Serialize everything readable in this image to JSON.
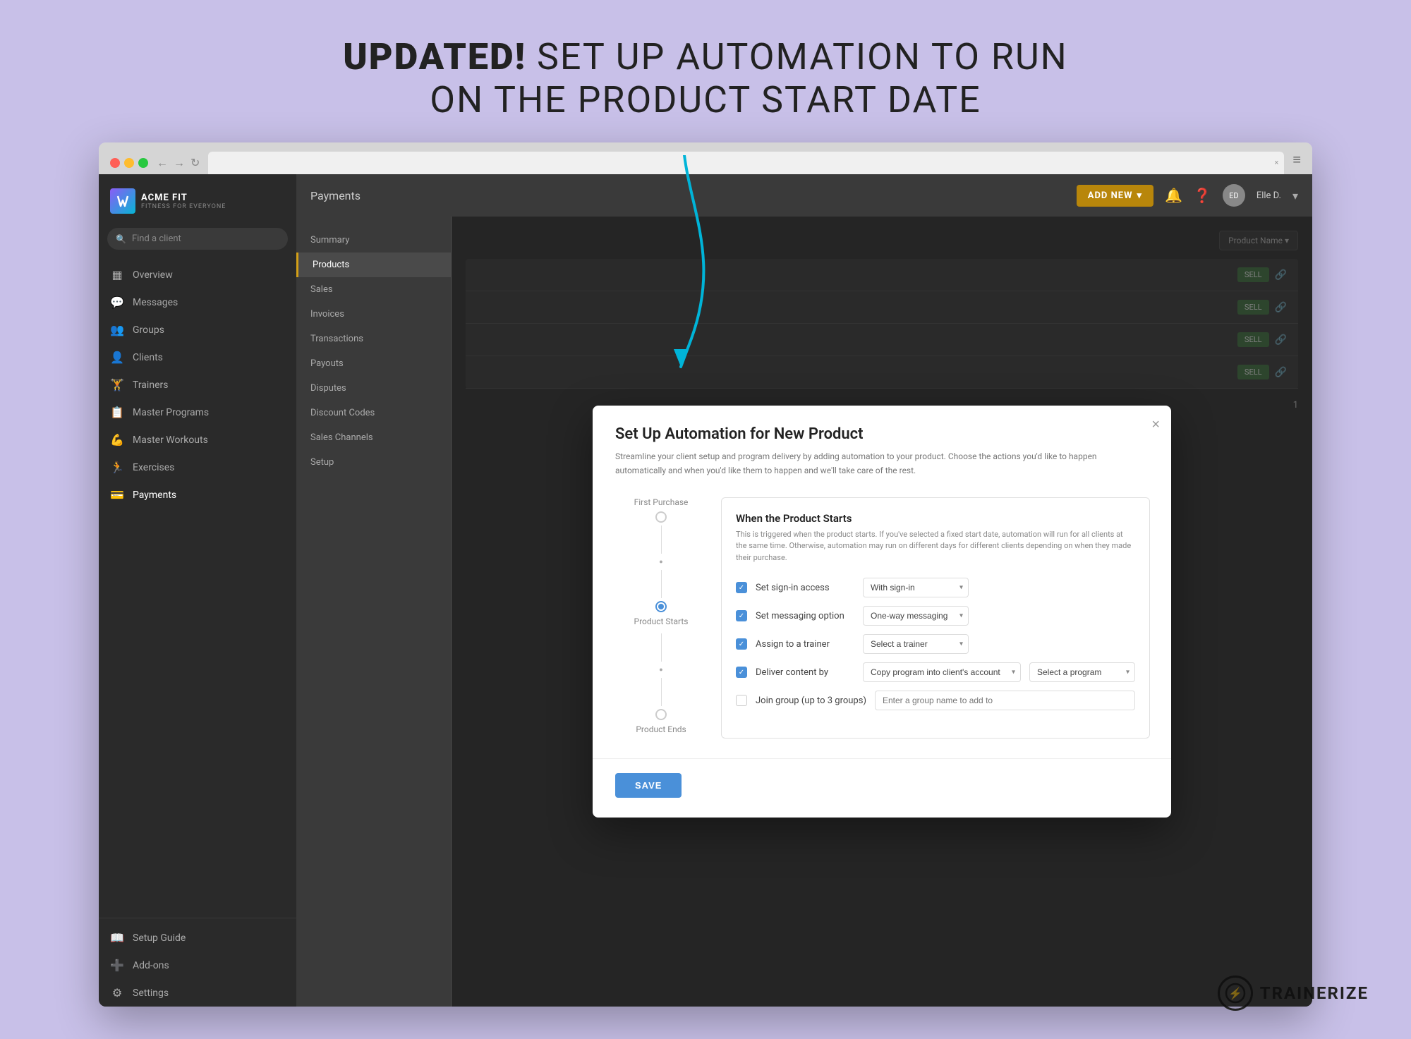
{
  "page": {
    "header_line1": "UPDATED! SET UP AUTOMATION TO RUN",
    "header_line2": "ON THE PRODUCT START DATE",
    "header_bold": "UPDATED!"
  },
  "browser": {
    "tab_label": "",
    "tab_close": "×",
    "menu_icon": "≡"
  },
  "sidebar": {
    "logo_text": "ACME FIT",
    "logo_sub": "FITNESS FOR EVERYONE",
    "search_placeholder": "Find a client",
    "items": [
      {
        "label": "Overview",
        "icon": "▦"
      },
      {
        "label": "Messages",
        "icon": "💬"
      },
      {
        "label": "Groups",
        "icon": "👥"
      },
      {
        "label": "Clients",
        "icon": "👤"
      },
      {
        "label": "Trainers",
        "icon": "🏋"
      },
      {
        "label": "Master Programs",
        "icon": "📋"
      },
      {
        "label": "Master Workouts",
        "icon": "💪"
      },
      {
        "label": "Exercises",
        "icon": "🏃"
      },
      {
        "label": "Payments",
        "icon": "💳"
      }
    ],
    "bottom_items": [
      {
        "label": "Setup Guide",
        "icon": "📖"
      },
      {
        "label": "Add-ons",
        "icon": "➕"
      },
      {
        "label": "Settings",
        "icon": "⚙"
      }
    ]
  },
  "topbar": {
    "title": "Payments",
    "add_new": "ADD NEW",
    "user_name": "Elle D."
  },
  "sub_nav": {
    "items": [
      "Summary",
      "Products",
      "Sales",
      "Invoices",
      "Transactions",
      "Payouts",
      "Disputes",
      "Discount Codes",
      "Sales Channels",
      "Setup"
    ]
  },
  "left_sidebar": {
    "items": [
      "Summary",
      "Products",
      "Sales",
      "Invoices",
      "Transactions",
      "Payouts",
      "Disputes",
      "Discount Codes",
      "Sales Channels",
      "Setup"
    ]
  },
  "modal": {
    "title": "Set Up Automation for New Product",
    "description": "Streamline your client setup and program delivery by adding automation to your product. Choose the actions you'd like to happen automatically and when you'd like them to happen and we'll take care of the rest.",
    "close_label": "×",
    "timeline": [
      {
        "label": "First Purchase",
        "state": "unchecked"
      },
      {
        "label": "Product Starts",
        "state": "active"
      },
      {
        "label": "Product Ends",
        "state": "unchecked"
      }
    ],
    "section_title": "When the Product Starts",
    "section_description": "This is triggered when the product starts. If you've selected a fixed start date, automation will run for all clients at the same time. Otherwise, automation may run on different days for different clients depending on when they made their purchase.",
    "rows": [
      {
        "checked": true,
        "label": "Set sign-in access",
        "dropdown1": "With sign-in",
        "dropdown2": null,
        "input": null
      },
      {
        "checked": true,
        "label": "Set messaging option",
        "dropdown1": "One-way messaging",
        "dropdown2": null,
        "input": null
      },
      {
        "checked": true,
        "label": "Assign to a trainer",
        "dropdown1": "Select a trainer",
        "dropdown2": null,
        "input": null
      },
      {
        "checked": true,
        "label": "Deliver content by",
        "dropdown1": "Copy program into client's account",
        "dropdown2": "Select a program",
        "input": null
      },
      {
        "checked": false,
        "label": "Join group (up to 3 groups)",
        "dropdown1": null,
        "dropdown2": null,
        "input": "Enter a group name to add to"
      }
    ],
    "save_label": "SAVE"
  },
  "trainerize": {
    "brand_name": "TRAINERIZE",
    "icon": "⚡"
  }
}
